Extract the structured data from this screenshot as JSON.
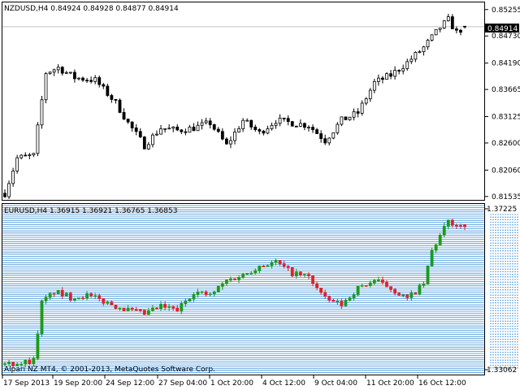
{
  "window": {
    "background": "#ffffff",
    "grid_color": "#000000"
  },
  "top_panel": {
    "header": "NZDUSD,H4  0.84924 0.84928 0.84877 0.84914",
    "symbol": "NZDUSD",
    "timeframe": "H4",
    "ohlc": [
      "0.84924",
      "0.84928",
      "0.84877",
      "0.84914"
    ],
    "current_price_label": "0.84914",
    "price_line_color": "#c0c0c0",
    "candle_color": "#000000",
    "y_ticks": [
      "0.85255",
      "0.84730",
      "0.84190",
      "0.83665",
      "0.83125",
      "0.82600",
      "0.82060",
      "0.81535"
    ]
  },
  "bottom_panel": {
    "header": "EURUSD,H4  1.36915 1.36921 1.36765 1.36853",
    "symbol": "EURUSD",
    "timeframe": "H4",
    "ohlc": [
      "1.36915",
      "1.36921",
      "1.36765",
      "1.36853"
    ],
    "top_price_label": "1.37225",
    "bottom_price_label": "1.33062",
    "line_color": "#3e8fd6",
    "bull_color": "#1a9a1a",
    "bear_color": "#e0202a",
    "copyright": "Alpari NZ MT4, © 2001-2013, MetaQuotes Software Corp."
  },
  "x_axis": {
    "labels": [
      "17 Sep 2013",
      "19 Sep 20:00",
      "24 Sep 12:00",
      "27 Sep 04:00",
      "1 Oct 20:00",
      "4 Oct 12:00",
      "9 Oct 04:00",
      "11 Oct 20:00",
      "16 Oct 12:00"
    ]
  },
  "chart_data": [
    {
      "type": "candlestick",
      "title": "NZDUSD,H4",
      "x": [
        "17 Sep 2013",
        "19 Sep 20:00",
        "24 Sep 12:00",
        "27 Sep 04:00",
        "1 Oct 20:00",
        "4 Oct 12:00",
        "9 Oct 04:00",
        "11 Oct 20:00",
        "16 Oct 12:00"
      ],
      "ylim": [
        0.815,
        0.853
      ],
      "y_ticks": [
        0.85255,
        0.8473,
        0.8419,
        0.83665,
        0.83125,
        0.826,
        0.8206,
        0.81535
      ],
      "approx_close_path": [
        [
          0,
          0.816
        ],
        [
          3,
          0.823
        ],
        [
          7,
          0.8235
        ],
        [
          10,
          0.84
        ],
        [
          13,
          0.841
        ],
        [
          17,
          0.839
        ],
        [
          22,
          0.8385
        ],
        [
          27,
          0.834
        ],
        [
          30,
          0.83
        ],
        [
          34,
          0.8255
        ],
        [
          38,
          0.829
        ],
        [
          42,
          0.8285
        ],
        [
          46,
          0.829
        ],
        [
          50,
          0.83
        ],
        [
          54,
          0.8255
        ],
        [
          58,
          0.8305
        ],
        [
          62,
          0.828
        ],
        [
          66,
          0.8305
        ],
        [
          70,
          0.83
        ],
        [
          74,
          0.8295
        ],
        [
          78,
          0.8265
        ],
        [
          82,
          0.8305
        ],
        [
          86,
          0.832
        ],
        [
          90,
          0.838
        ],
        [
          94,
          0.8395
        ],
        [
          98,
          0.842
        ],
        [
          102,
          0.845
        ],
        [
          106,
          0.849
        ],
        [
          108,
          0.8505
        ],
        [
          110,
          0.848
        ],
        [
          112,
          0.8491
        ]
      ],
      "last": {
        "open": 0.84924,
        "high": 0.84928,
        "low": 0.84877,
        "close": 0.84914
      }
    },
    {
      "type": "candlestick",
      "title": "EURUSD,H4",
      "x": [
        "17 Sep 2013",
        "19 Sep 20:00",
        "24 Sep 12:00",
        "27 Sep 04:00",
        "1 Oct 20:00",
        "4 Oct 12:00",
        "9 Oct 04:00",
        "11 Oct 20:00",
        "16 Oct 12:00"
      ],
      "ylim": [
        1.3306,
        1.3723
      ],
      "y_ticks": [
        1.37225,
        1.33062
      ],
      "approx_close_path": [
        [
          0,
          1.3315
        ],
        [
          5,
          1.332
        ],
        [
          7,
          1.3325
        ],
        [
          9,
          1.348
        ],
        [
          12,
          1.351
        ],
        [
          16,
          1.3495
        ],
        [
          20,
          1.35
        ],
        [
          25,
          1.348
        ],
        [
          30,
          1.346
        ],
        [
          34,
          1.345
        ],
        [
          38,
          1.347
        ],
        [
          42,
          1.346
        ],
        [
          46,
          1.351
        ],
        [
          50,
          1.35
        ],
        [
          54,
          1.354
        ],
        [
          58,
          1.3555
        ],
        [
          62,
          1.358
        ],
        [
          66,
          1.359
        ],
        [
          70,
          1.356
        ],
        [
          74,
          1.355
        ],
        [
          78,
          1.349
        ],
        [
          82,
          1.3475
        ],
        [
          86,
          1.352
        ],
        [
          90,
          1.354
        ],
        [
          94,
          1.352
        ],
        [
          98,
          1.349
        ],
        [
          102,
          1.353
        ],
        [
          104,
          1.362
        ],
        [
          108,
          1.37
        ],
        [
          110,
          1.369
        ],
        [
          112,
          1.3685
        ]
      ],
      "last": {
        "open": 1.36915,
        "high": 1.36921,
        "low": 1.36765,
        "close": 1.36853
      }
    }
  ]
}
